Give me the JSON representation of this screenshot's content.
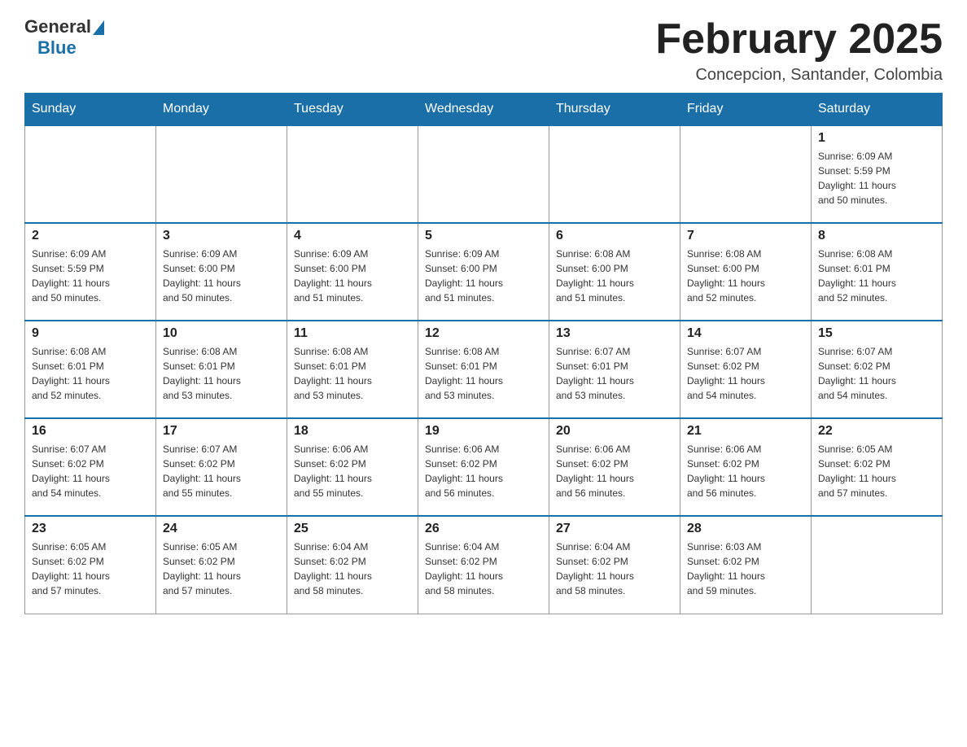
{
  "header": {
    "logo_general": "General",
    "logo_blue": "Blue",
    "title": "February 2025",
    "location": "Concepcion, Santander, Colombia"
  },
  "weekdays": [
    "Sunday",
    "Monday",
    "Tuesday",
    "Wednesday",
    "Thursday",
    "Friday",
    "Saturday"
  ],
  "weeks": [
    [
      {
        "day": "",
        "info": ""
      },
      {
        "day": "",
        "info": ""
      },
      {
        "day": "",
        "info": ""
      },
      {
        "day": "",
        "info": ""
      },
      {
        "day": "",
        "info": ""
      },
      {
        "day": "",
        "info": ""
      },
      {
        "day": "1",
        "info": "Sunrise: 6:09 AM\nSunset: 5:59 PM\nDaylight: 11 hours\nand 50 minutes."
      }
    ],
    [
      {
        "day": "2",
        "info": "Sunrise: 6:09 AM\nSunset: 5:59 PM\nDaylight: 11 hours\nand 50 minutes."
      },
      {
        "day": "3",
        "info": "Sunrise: 6:09 AM\nSunset: 6:00 PM\nDaylight: 11 hours\nand 50 minutes."
      },
      {
        "day": "4",
        "info": "Sunrise: 6:09 AM\nSunset: 6:00 PM\nDaylight: 11 hours\nand 51 minutes."
      },
      {
        "day": "5",
        "info": "Sunrise: 6:09 AM\nSunset: 6:00 PM\nDaylight: 11 hours\nand 51 minutes."
      },
      {
        "day": "6",
        "info": "Sunrise: 6:08 AM\nSunset: 6:00 PM\nDaylight: 11 hours\nand 51 minutes."
      },
      {
        "day": "7",
        "info": "Sunrise: 6:08 AM\nSunset: 6:00 PM\nDaylight: 11 hours\nand 52 minutes."
      },
      {
        "day": "8",
        "info": "Sunrise: 6:08 AM\nSunset: 6:01 PM\nDaylight: 11 hours\nand 52 minutes."
      }
    ],
    [
      {
        "day": "9",
        "info": "Sunrise: 6:08 AM\nSunset: 6:01 PM\nDaylight: 11 hours\nand 52 minutes."
      },
      {
        "day": "10",
        "info": "Sunrise: 6:08 AM\nSunset: 6:01 PM\nDaylight: 11 hours\nand 53 minutes."
      },
      {
        "day": "11",
        "info": "Sunrise: 6:08 AM\nSunset: 6:01 PM\nDaylight: 11 hours\nand 53 minutes."
      },
      {
        "day": "12",
        "info": "Sunrise: 6:08 AM\nSunset: 6:01 PM\nDaylight: 11 hours\nand 53 minutes."
      },
      {
        "day": "13",
        "info": "Sunrise: 6:07 AM\nSunset: 6:01 PM\nDaylight: 11 hours\nand 53 minutes."
      },
      {
        "day": "14",
        "info": "Sunrise: 6:07 AM\nSunset: 6:02 PM\nDaylight: 11 hours\nand 54 minutes."
      },
      {
        "day": "15",
        "info": "Sunrise: 6:07 AM\nSunset: 6:02 PM\nDaylight: 11 hours\nand 54 minutes."
      }
    ],
    [
      {
        "day": "16",
        "info": "Sunrise: 6:07 AM\nSunset: 6:02 PM\nDaylight: 11 hours\nand 54 minutes."
      },
      {
        "day": "17",
        "info": "Sunrise: 6:07 AM\nSunset: 6:02 PM\nDaylight: 11 hours\nand 55 minutes."
      },
      {
        "day": "18",
        "info": "Sunrise: 6:06 AM\nSunset: 6:02 PM\nDaylight: 11 hours\nand 55 minutes."
      },
      {
        "day": "19",
        "info": "Sunrise: 6:06 AM\nSunset: 6:02 PM\nDaylight: 11 hours\nand 56 minutes."
      },
      {
        "day": "20",
        "info": "Sunrise: 6:06 AM\nSunset: 6:02 PM\nDaylight: 11 hours\nand 56 minutes."
      },
      {
        "day": "21",
        "info": "Sunrise: 6:06 AM\nSunset: 6:02 PM\nDaylight: 11 hours\nand 56 minutes."
      },
      {
        "day": "22",
        "info": "Sunrise: 6:05 AM\nSunset: 6:02 PM\nDaylight: 11 hours\nand 57 minutes."
      }
    ],
    [
      {
        "day": "23",
        "info": "Sunrise: 6:05 AM\nSunset: 6:02 PM\nDaylight: 11 hours\nand 57 minutes."
      },
      {
        "day": "24",
        "info": "Sunrise: 6:05 AM\nSunset: 6:02 PM\nDaylight: 11 hours\nand 57 minutes."
      },
      {
        "day": "25",
        "info": "Sunrise: 6:04 AM\nSunset: 6:02 PM\nDaylight: 11 hours\nand 58 minutes."
      },
      {
        "day": "26",
        "info": "Sunrise: 6:04 AM\nSunset: 6:02 PM\nDaylight: 11 hours\nand 58 minutes."
      },
      {
        "day": "27",
        "info": "Sunrise: 6:04 AM\nSunset: 6:02 PM\nDaylight: 11 hours\nand 58 minutes."
      },
      {
        "day": "28",
        "info": "Sunrise: 6:03 AM\nSunset: 6:02 PM\nDaylight: 11 hours\nand 59 minutes."
      },
      {
        "day": "",
        "info": ""
      }
    ]
  ]
}
